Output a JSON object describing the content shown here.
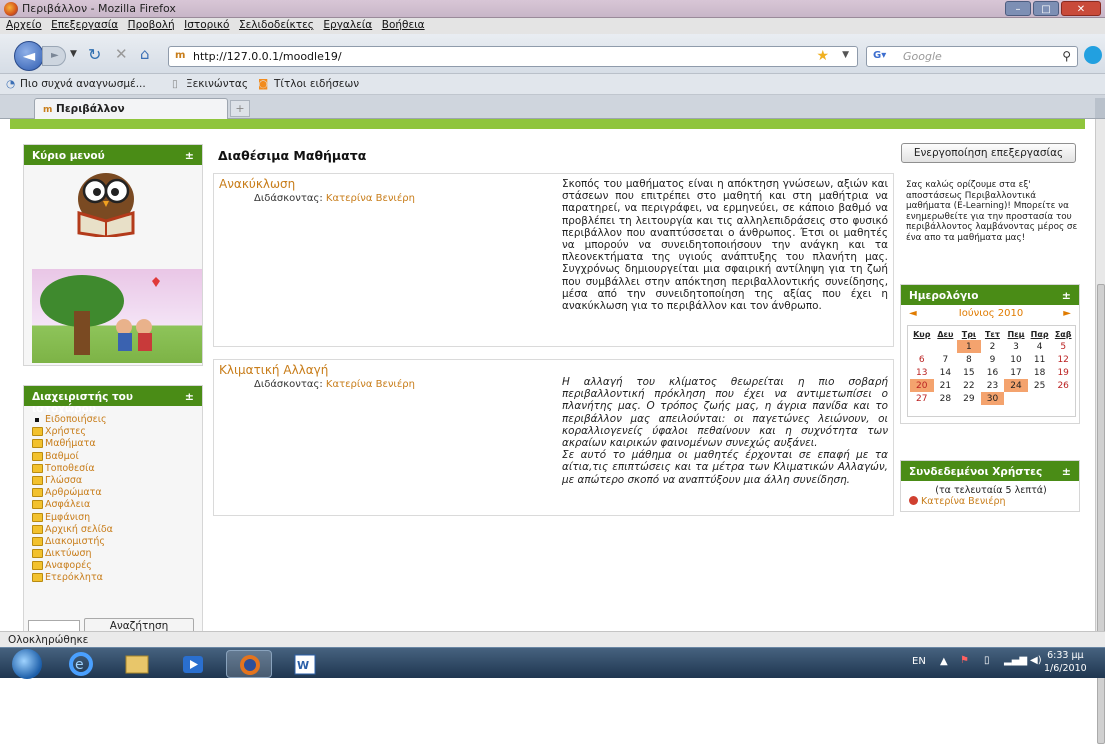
{
  "window": {
    "title": "Περιβάλλον - Mozilla Firefox"
  },
  "menu": [
    "Αρχείο",
    "Επεξεργασία",
    "Προβολή",
    "Ιστορικό",
    "Σελιδοδείκτες",
    "Εργαλεία",
    "Βοήθεια"
  ],
  "nav": {
    "url": "http://127.0.0.1/moodle19/",
    "search_placeholder": "Google"
  },
  "bookmarks": [
    "Πιο συχνά αναγνωσμέ...",
    "Ξεκινώντας",
    "Τίτλοι ειδήσεων"
  ],
  "tab": {
    "label": "Περιβάλλον",
    "new": "+"
  },
  "main_menu": {
    "title": "Κύριο μενού",
    "toggle": "±"
  },
  "site_admin": {
    "title": "Διαχειριστής του ιστοχώρου",
    "toggle": "±",
    "items": [
      "Ειδοποιήσεις",
      "Χρήστες",
      "Μαθήματα",
      "Βαθμοί",
      "Τοποθεσία",
      "Γλώσσα",
      "Αρθρώματα",
      "Ασφάλεια",
      "Εμφάνιση",
      "Αρχική σελίδα",
      "Διακομιστής",
      "Δικτύωση",
      "Αναφορές",
      "Ετερόκλητα"
    ],
    "search_button": "Αναζήτηση"
  },
  "courses": {
    "heading": "Διαθέσιμα Μαθήματα",
    "list": [
      {
        "title": "Ανακύκλωση",
        "teacher_label": "Διδάσκοντας:",
        "teacher": "Κατερίνα Βενιέρη",
        "description": "Σκοπός του μαθήματος είναι η απόκτηση γνώσεων, αξιών και στάσεων που επιτρέπει στο μαθητή και στη μαθήτρια να παρατηρεί, να περιγράφει, να ερμηνεύει, σε κάποιο βαθμό να προβλέπει τη λειτουργία και τις αλληλεπιδράσεις στο φυσικό περιβάλλον που αναπτύσσεται ο άνθρωπος. Έτσι οι μαθητές να μπορούν να συνειδητοποιήσουν την ανάγκη και τα πλεονεκτήματα της υγιούς ανάπτυξης του πλανήτη μας. Συγχρόνως δημιουργείται μια σφαιρική αντίληψη για τη ζωή που συμβάλλει στην απόκτηση περιβαλλοντικής συνείδησης, μέσα από την συνειδητοποίηση της αξίας που έχει η ανακύκλωση για το περιβάλλον και τον άνθρωπο."
      },
      {
        "title": "Κλιματική Αλλαγή",
        "teacher_label": "Διδάσκοντας:",
        "teacher": "Κατερίνα Βενιέρη",
        "description": "Η αλλαγή του κλίματος θεωρείται η πιο σοβαρή περιβαλλοντική πρόκληση που έχει να αντιμετωπίσει ο πλανήτης μας. Ο τρόπος ζωής μας, η άγρια πανίδα και το περιβάλλον μας απειλούνται: οι παγετώνες λειώνουν, οι κοραλλιογενείς ύφαλοι πεθαίνουν και η συχνότητα των ακραίων καιρικών φαινομένων συνεχώς αυξάνει.",
        "description2": "Σε αυτό το μάθημα οι μαθητές έρχονται σε επαφή με τα αίτια,τις επιπτώσεις και τα μέτρα των Κλιματικών Αλλαγών, με απώτερο σκοπό να αναπτύξουν μια άλλη συνείδηση."
      }
    ]
  },
  "edit_button": "Ενεργοποίηση επεξεργασίας",
  "welcome": "Σας καλώς ορίζουμε στα εξ' αποστάσεως Περιβαλλοντικά μαθήματα (E-Learning)! Μπορείτε να ενημερωθείτε για την προστασία του περιβάλλοντος λαμβάνοντας μέρος σε ένα απο τα μαθήματα μας!",
  "calendar": {
    "title": "Ημερολόγιο",
    "toggle": "±",
    "month": "Ιούνιος 2010",
    "prev": "◄",
    "next": "►",
    "days": [
      "Κυρ",
      "Δευ",
      "Τρι",
      "Τετ",
      "Πεμ",
      "Παρ",
      "Σαβ"
    ]
  },
  "online_users": {
    "title": "Συνδεδεμένοι Χρήστες",
    "toggle": "±",
    "subtitle": "(τα τελευταία 5 λεπτά)",
    "user": "Κατερίνα Βενιέρη"
  },
  "status": "Ολοκληρώθηκε",
  "taskbar": {
    "lang": "EN",
    "time": "6:33 μμ",
    "date": "1/6/2010"
  },
  "colors": {
    "green": "#4a8c16",
    "link": "#c87d1a",
    "event": "#f4a36e"
  }
}
